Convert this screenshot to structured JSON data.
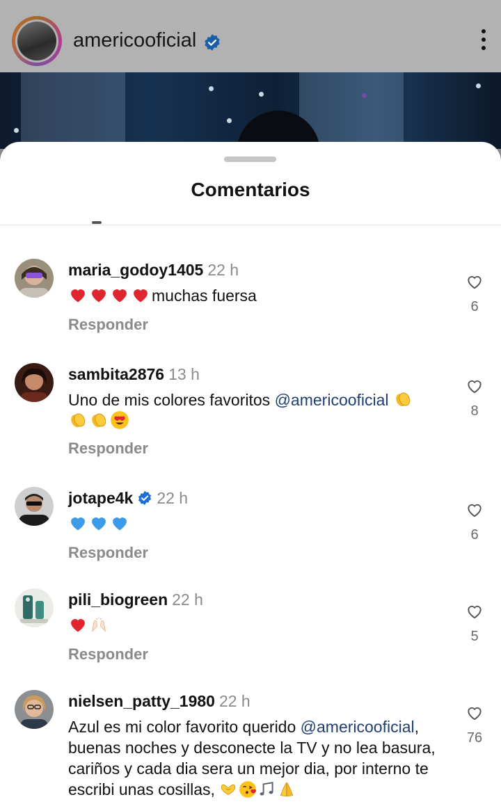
{
  "post": {
    "username": "americooficial",
    "verified": true,
    "menu_icon": "more-vertical-icon"
  },
  "sheet": {
    "title": "Comentarios"
  },
  "comments": [
    {
      "username": "maria_godoy1405",
      "time": "22 h",
      "verified": false,
      "text": "muchas fuersa",
      "emojis_before": [
        "red-heart",
        "red-heart",
        "red-heart",
        "red-heart"
      ],
      "reply_label": "Responder",
      "likes": "6"
    },
    {
      "username": "sambita2876",
      "time": "13 h",
      "verified": false,
      "text": "Uno de mis colores favoritos ",
      "mention": "@americooficial",
      "emojis_after": [
        "clapping-hands",
        "clapping-hands",
        "clapping-hands",
        "heart-eyes"
      ],
      "reply_label": "Responder",
      "likes": "8"
    },
    {
      "username": "jotape4k",
      "time": "22 h",
      "verified": true,
      "emojis_before": [
        "blue-heart",
        "blue-heart",
        "blue-heart"
      ],
      "reply_label": "Responder",
      "likes": "6"
    },
    {
      "username": "pili_biogreen",
      "time": "22 h",
      "verified": false,
      "emojis_before": [
        "red-heart",
        "raising-hands"
      ],
      "reply_label": "Responder",
      "likes": "5"
    },
    {
      "username": "nielsen_patty_1980",
      "time": "22 h",
      "verified": false,
      "text_1": "Azul es mi color favorito querido ",
      "mention": "@americooficial",
      "text_2": ", buenas noches y desconecte la TV y no lea basura, cariños y cada dia sera un mejor dia, por interno te escribi unas cosillas, ",
      "emojis_after": [
        "heart-hands",
        "kissing-face",
        "musical-notes",
        "folded-hands"
      ],
      "likes": "76"
    }
  ],
  "colors": {
    "mention": "#1f3f6e",
    "verified": "#1d6fd6",
    "secondary_text": "#8a8a8a"
  }
}
